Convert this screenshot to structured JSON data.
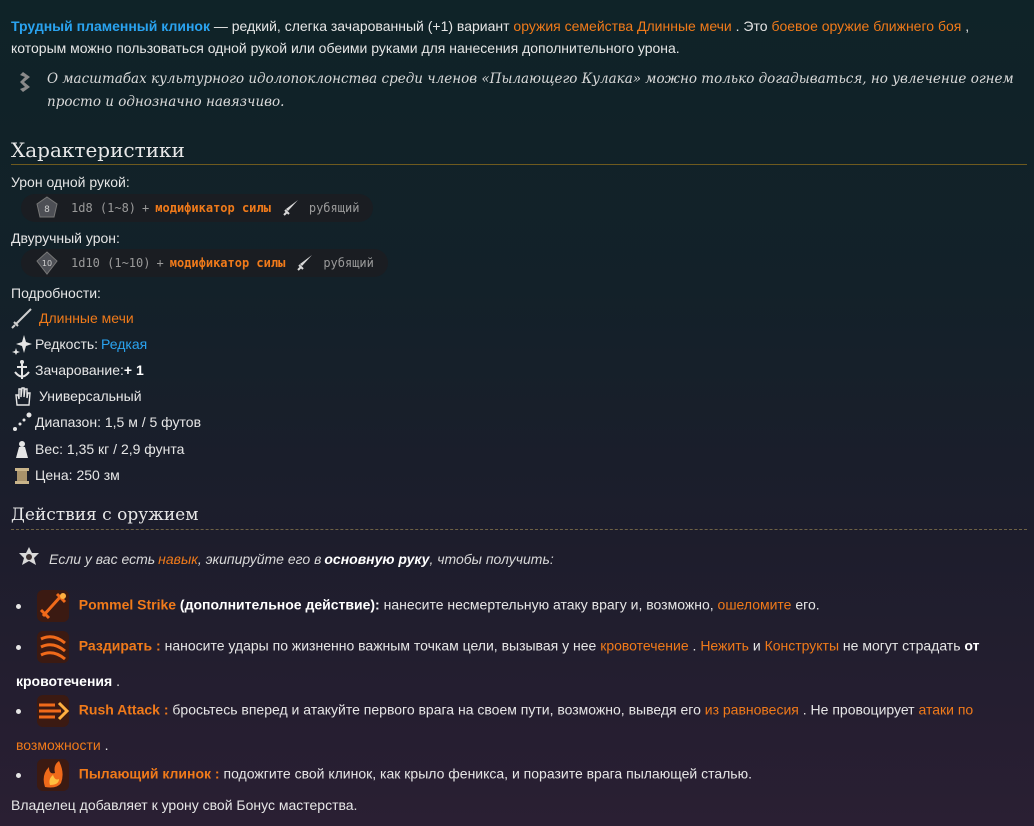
{
  "intro": {
    "item_name": "Трудный пламенный клинок",
    "text1": " — редкий, слегка зачарованный (+1) вариант ",
    "link_family": "оружия семейства Длинные мечи",
    "text2": " . Это ",
    "link_melee": "боевое оружие ближнего боя",
    "text3": " , которым можно пользоваться одной рукой или обеими руками для нанесения дополнительного урона."
  },
  "quote": {
    "icon": "scroll-icon",
    "text": "О масштабах культурного идолопоклонства среди членов «Пылающего Кулака» можно только догадываться, но увлечение огнем просто и однозначно навязчиво."
  },
  "stats": {
    "heading": "Характеристики",
    "one_hand_label": "Урон одной рукой:",
    "one_hand": {
      "dice": "1d8 (1~8)",
      "plus": "+",
      "modifier": "модификатор силы",
      "type": "рубящий",
      "die_face": "8"
    },
    "two_hand_label": "Двуручный урон:",
    "two_hand": {
      "dice": "1d10 (1~10)",
      "plus": "+",
      "modifier": "модификатор силы",
      "type": "рубящий",
      "die_face": "10"
    },
    "details_label": "Подробности:",
    "family": "Длинные мечи",
    "rarity_label": "Редкость: ",
    "rarity": "Редкая",
    "enchant_label": "Зачарование: ",
    "enchant": "+ 1",
    "versatile": "Универсальный",
    "range": "Диапазон: 1,5 м / 5 футов",
    "weight": "Вес: 1,35 кг / 2,9 фунта",
    "price": "Цена: 250 зм"
  },
  "actions": {
    "heading": "Действия с оружием",
    "note_prefix": "Если у вас есть ",
    "note_link": "навык",
    "note_mid": " , экипируйте его в ",
    "note_bold": "основную руку",
    "note_suffix": " , чтобы получить:",
    "items": [
      {
        "name": "Pommel Strike",
        "bold_after": " (дополнительное действие):",
        "text_a": " нанесите несмертельную атаку врагу и, возможно, ",
        "link_a": "ошеломите",
        "text_b": " его."
      },
      {
        "name": "Раздирать :",
        "text_a": " наносите удары по жизненно важным точкам цели, вызывая у нее ",
        "link_a": "кровотечение",
        "text_b": " . ",
        "link_b": "Нежить",
        "text_c": " и ",
        "link_c": "Конструкты",
        "text_d": " не могут страдать ",
        "bold_end": "от кровотечения",
        "text_e": " ."
      },
      {
        "name": "Rush Attack :",
        "text_a": " бросьтесь вперед и атакуйте первого врага на своем пути, возможно, выведя его ",
        "link_a": "из равновесия",
        "text_b": " . Не провоцирует ",
        "link_b": "атаки по возможности",
        "text_c": " ."
      },
      {
        "name": "Пылающий клинок :",
        "text_a": " подожгите свой клинок, как крыло феникса, и поразите врага пылающей сталью."
      }
    ],
    "footer": "Владелец добавляет к урону свой Бонус мастерства."
  }
}
